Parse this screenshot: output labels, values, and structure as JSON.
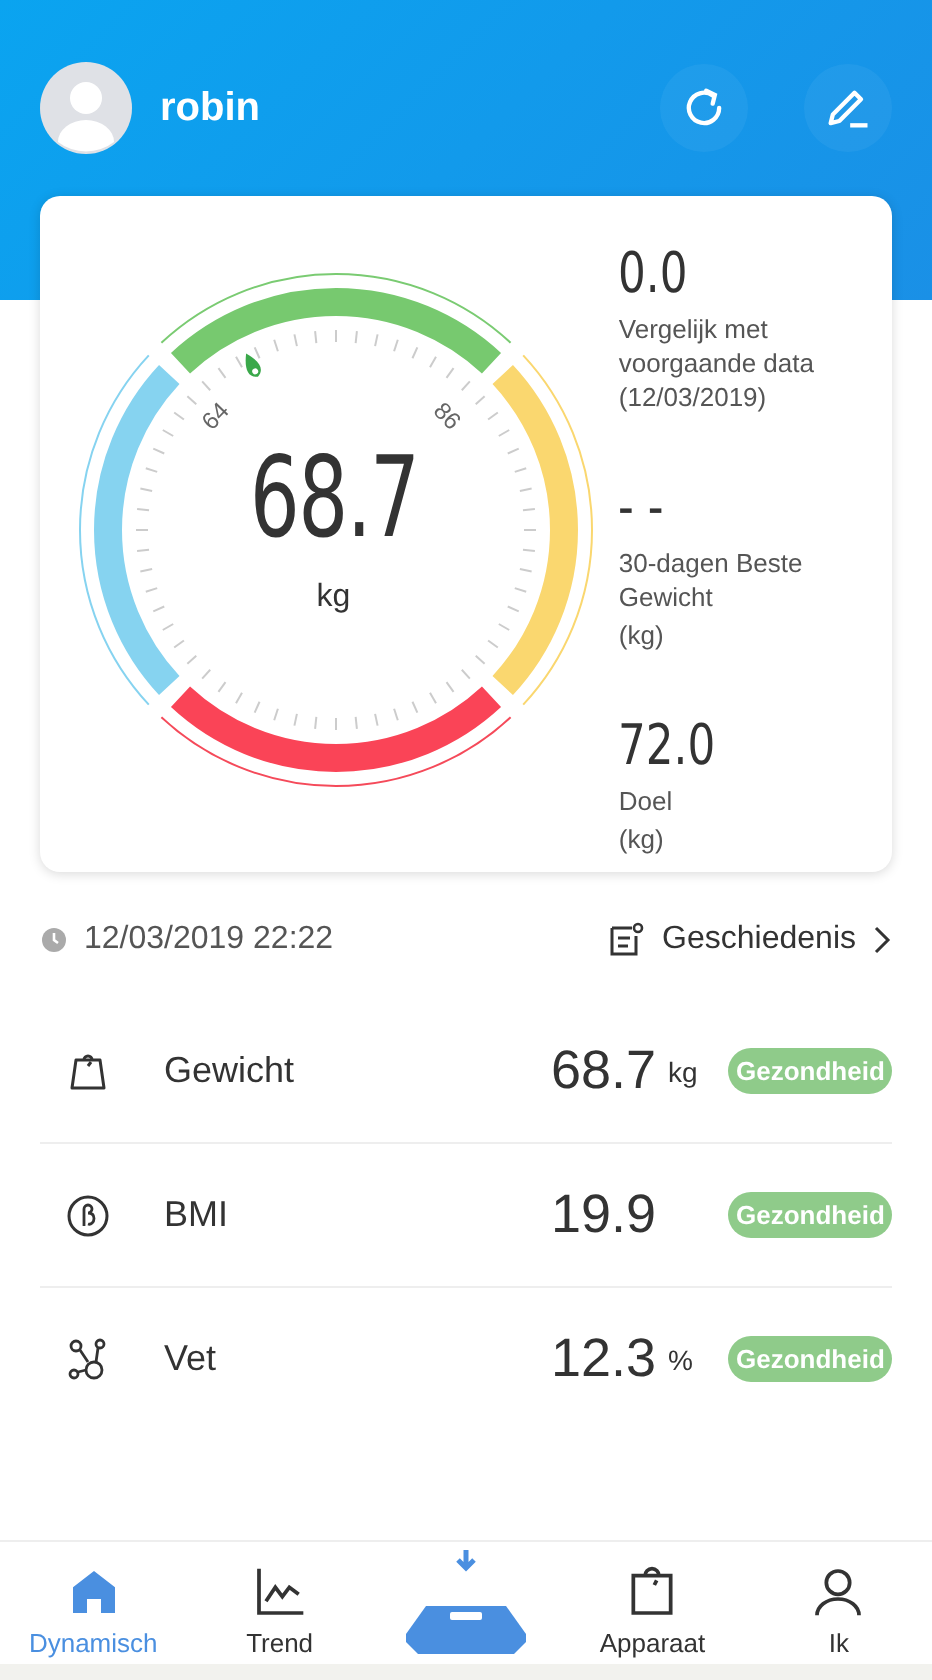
{
  "header": {
    "user_name": "robin"
  },
  "gauge": {
    "value": "68.7",
    "unit": "kg",
    "range_low": "64",
    "range_high": "86"
  },
  "stats": [
    {
      "value": "0.0",
      "label": "Vergelijk met voorgaande data (12/03/2019)"
    },
    {
      "value": "- -",
      "label": "30-dagen Beste Gewicht",
      "unit": "(kg)"
    },
    {
      "value": "72.0",
      "label": "Doel",
      "unit": "(kg)"
    }
  ],
  "measurement": {
    "timestamp": "12/03/2019 22:22",
    "history_link": "Geschiedenis"
  },
  "metrics": [
    {
      "kind": "weight",
      "name": "Gewicht",
      "value": "68.7",
      "unit": "kg",
      "badge": "Gezondheid",
      "color": "#8fcb8a"
    },
    {
      "kind": "bmi",
      "name": "BMI",
      "value": "19.9",
      "badge": "Gezondheid",
      "color": "#8fcb8a"
    },
    {
      "kind": "fat",
      "name": "Vet",
      "value": "12.3",
      "unit": "%",
      "badge": "Gezondheid",
      "color": "#8fcb8a"
    }
  ],
  "nav": [
    {
      "kind": "home",
      "label": "Dynamisch",
      "selected": true
    },
    {
      "kind": "trend",
      "label": "Trend",
      "selected": false
    },
    {
      "kind": "scale",
      "selected": false
    },
    {
      "kind": "device",
      "label": "Apparaat",
      "selected": false
    },
    {
      "kind": "profile",
      "label": "Ik",
      "selected": false
    }
  ]
}
